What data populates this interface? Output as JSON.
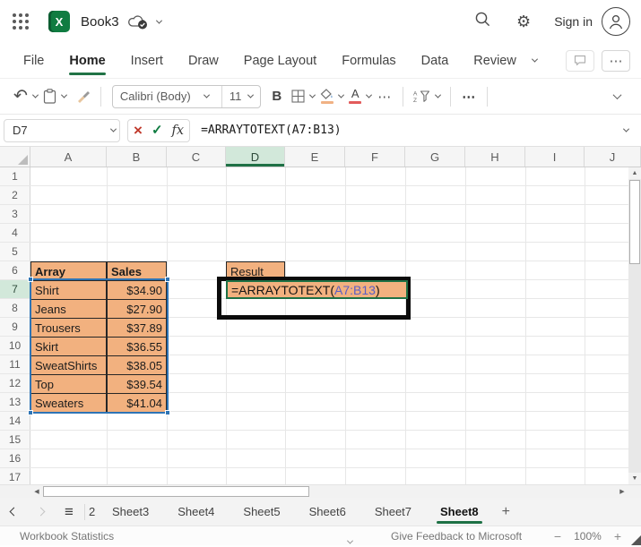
{
  "titlebar": {
    "app_icon_letter": "X",
    "doc_title": "Book3",
    "sign_in_label": "Sign in"
  },
  "menubar": {
    "items": [
      "File",
      "Home",
      "Insert",
      "Draw",
      "Page Layout",
      "Formulas",
      "Data",
      "Review"
    ],
    "active_item": "Home"
  },
  "toolbar": {
    "font_name": "Calibri (Body)",
    "font_size": "11",
    "bold_label": "B",
    "more_glyph": "⋯"
  },
  "formula_bar": {
    "name_box_value": "D7",
    "cancel_glyph": "×",
    "confirm_glyph": "✓",
    "fx_label": "fx",
    "formula": "=ARRAYTOTEXT(A7:B13)"
  },
  "sheet": {
    "columns": [
      "A",
      "B",
      "C",
      "D",
      "E",
      "F",
      "G",
      "H",
      "I",
      "J"
    ],
    "active_column": "D",
    "row_count": 17,
    "active_row": 7,
    "cells": [
      {
        "ref": "A6",
        "text": "Array",
        "bold": true
      },
      {
        "ref": "B6",
        "text": "Sales",
        "bold": true
      },
      {
        "ref": "D6",
        "text": "Result"
      },
      {
        "ref": "A7",
        "text": "Shirt"
      },
      {
        "ref": "B7",
        "text": "$34.90",
        "align": "right"
      },
      {
        "ref": "A8",
        "text": "Jeans"
      },
      {
        "ref": "B8",
        "text": "$27.90",
        "align": "right"
      },
      {
        "ref": "A9",
        "text": "Trousers"
      },
      {
        "ref": "B9",
        "text": "$37.89",
        "align": "right"
      },
      {
        "ref": "A10",
        "text": "Skirt"
      },
      {
        "ref": "B10",
        "text": "$36.55",
        "align": "right"
      },
      {
        "ref": "A11",
        "text": "SweatShirts"
      },
      {
        "ref": "B11",
        "text": "$38.05",
        "align": "right"
      },
      {
        "ref": "A12",
        "text": "Top"
      },
      {
        "ref": "B12",
        "text": "$39.54",
        "align": "right"
      },
      {
        "ref": "A13",
        "text": "Sweaters"
      },
      {
        "ref": "B13",
        "text": "$41.04",
        "align": "right"
      }
    ],
    "edit_cell": {
      "ref": "D7",
      "formula_pre": "=ARRAYTOTEXT(",
      "formula_range": "A7:B13",
      "formula_post": ")"
    }
  },
  "tabs": {
    "partial_tab": "2",
    "sheets": [
      "Sheet3",
      "Sheet4",
      "Sheet5",
      "Sheet6",
      "Sheet7",
      "Sheet8"
    ],
    "active_tab": "Sheet8",
    "add_label": "+"
  },
  "statusbar": {
    "left_label": "Workbook Statistics",
    "feedback_label": "Give Feedback to Microsoft",
    "zoom_out_glyph": "−",
    "zoom_level": "100%",
    "zoom_in_glyph": "+"
  },
  "colors": {
    "excel_green": "#107C41",
    "active_underline_green": "#1E7145",
    "cell_fill_orange": "#F2B17F",
    "selection_blue": "#2E74B5",
    "range_ref_blue": "#5C5FC5",
    "font_color_swatch_red": "#E25B5B",
    "fill_swatch_peach": "#F0B184"
  }
}
